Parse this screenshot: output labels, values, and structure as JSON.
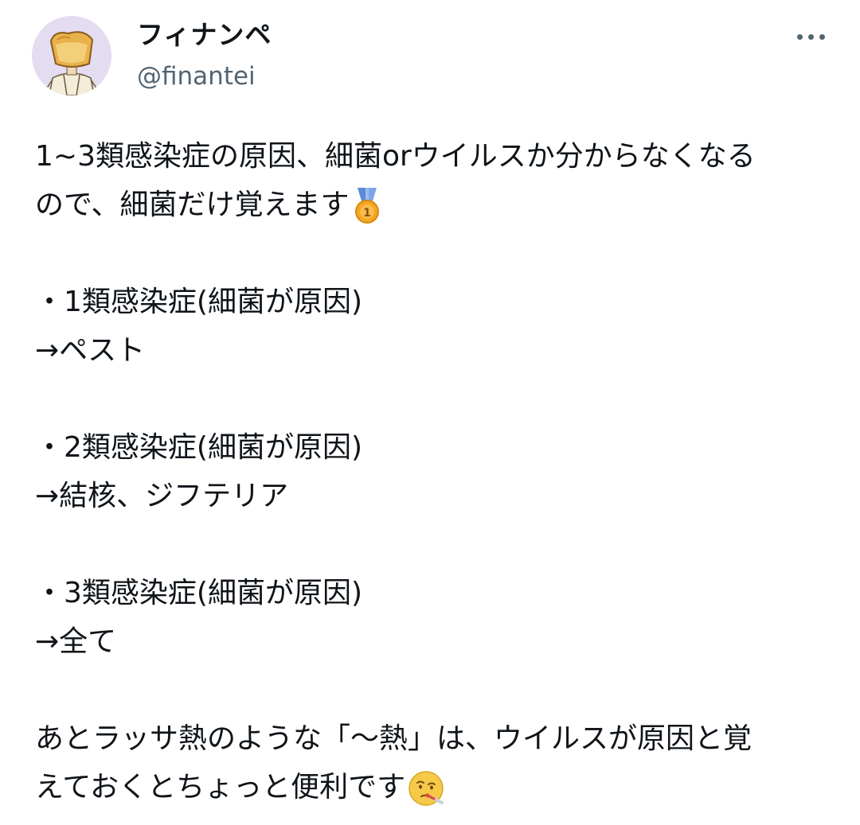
{
  "author": {
    "display_name": "フィナンペ",
    "handle": "@finantei",
    "avatar_icon": "cartoon-character-avatar"
  },
  "more_icon": "more-options-icon",
  "tweet": {
    "line_1": "1~3類感染症の原因、細菌orウイルスか分からなくなる",
    "line_2": "ので、細菌だけ覚えます",
    "emoji_medal": "1st-place-medal-icon",
    "item_1_title": "・1類感染症(細菌が原因)",
    "item_1_answer": "→ペスト",
    "item_2_title": "・2類感染症(細菌が原因)",
    "item_2_answer": "→結核、ジフテリア",
    "item_3_title": "・3類感染症(細菌が原因)",
    "item_3_answer": "→全て",
    "closing_line_1": "あとラッサ熱のような「〜熱」は、ウイルスが原因と覚",
    "closing_line_2": "えておくとちょっと便利です",
    "emoji_sick": "face-with-thermometer-icon"
  },
  "colors": {
    "text_primary": "#0f1419",
    "text_secondary": "#536471",
    "avatar_bg": "#e4dcf0"
  }
}
